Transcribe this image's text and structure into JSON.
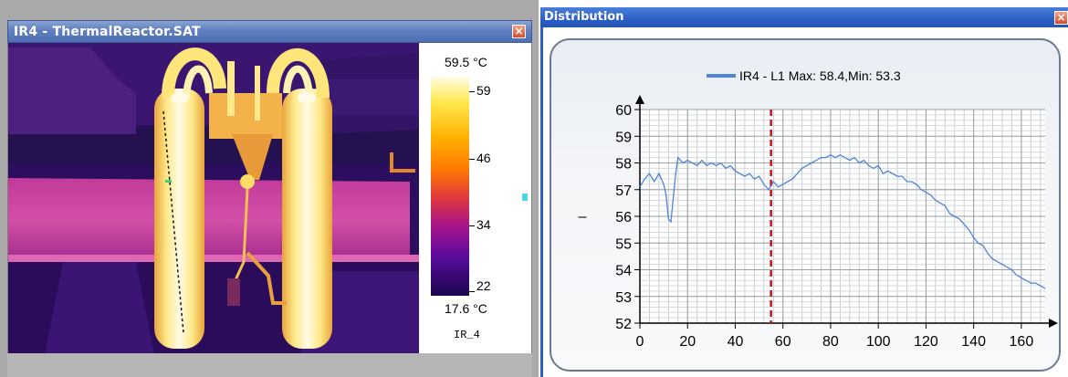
{
  "ir_window": {
    "title": "IR4 - ThermalReactor.SAT",
    "close_label": "×",
    "scale": {
      "max_label": "59.5 °C",
      "min_label": "17.6 °C",
      "name": "IR_4",
      "ticks": [
        "59",
        "46",
        "34",
        "22"
      ]
    }
  },
  "dist_window": {
    "title": "Distribution",
    "close_label": "×"
  },
  "chart_data": {
    "type": "line",
    "legend": "IR4 - L1 Max: 58.4,Min: 53.3",
    "xlabel": "",
    "ylabel": "–",
    "xlim": [
      0,
      170
    ],
    "ylim": [
      52,
      60
    ],
    "xticks": [
      0,
      20,
      40,
      60,
      80,
      100,
      120,
      140,
      160
    ],
    "yticks": [
      52,
      53,
      54,
      55,
      56,
      57,
      58,
      59,
      60
    ],
    "grid": true,
    "marker_x": 55,
    "series": [
      {
        "name": "IR4 - L1",
        "color": "#4f84d6",
        "x": [
          0,
          2,
          4,
          6,
          8,
          10,
          11,
          12,
          13,
          14,
          15,
          16,
          17,
          18,
          20,
          22,
          24,
          26,
          28,
          30,
          32,
          34,
          36,
          38,
          40,
          42,
          44,
          46,
          48,
          50,
          52,
          54,
          56,
          58,
          60,
          62,
          64,
          66,
          68,
          70,
          72,
          74,
          76,
          78,
          80,
          82,
          84,
          86,
          88,
          90,
          92,
          94,
          96,
          98,
          100,
          102,
          104,
          106,
          108,
          110,
          112,
          114,
          116,
          118,
          120,
          122,
          124,
          126,
          128,
          130,
          132,
          134,
          136,
          138,
          140,
          142,
          144,
          146,
          148,
          150,
          152,
          154,
          156,
          158,
          160,
          162,
          164,
          166,
          168,
          170
        ],
        "y": [
          57.1,
          57.4,
          57.6,
          57.3,
          57.6,
          57.2,
          56.8,
          55.9,
          55.8,
          56.7,
          57.6,
          58.2,
          58.1,
          58.0,
          58.1,
          58.0,
          57.9,
          58.1,
          57.9,
          58.0,
          57.9,
          58.0,
          57.8,
          57.9,
          57.7,
          57.6,
          57.5,
          57.6,
          57.4,
          57.5,
          57.2,
          57.0,
          57.3,
          57.1,
          57.2,
          57.3,
          57.4,
          57.6,
          57.8,
          57.9,
          58.0,
          58.1,
          58.2,
          58.2,
          58.3,
          58.2,
          58.3,
          58.2,
          58.1,
          58.2,
          58.0,
          58.1,
          57.9,
          57.8,
          57.9,
          57.6,
          57.7,
          57.6,
          57.5,
          57.5,
          57.3,
          57.3,
          57.2,
          57.0,
          56.9,
          56.8,
          56.6,
          56.5,
          56.4,
          56.1,
          56.0,
          55.9,
          55.7,
          55.5,
          55.2,
          55.0,
          54.9,
          54.6,
          54.4,
          54.3,
          54.2,
          54.1,
          54.0,
          53.8,
          53.7,
          53.6,
          53.5,
          53.5,
          53.4,
          53.3
        ]
      }
    ]
  }
}
